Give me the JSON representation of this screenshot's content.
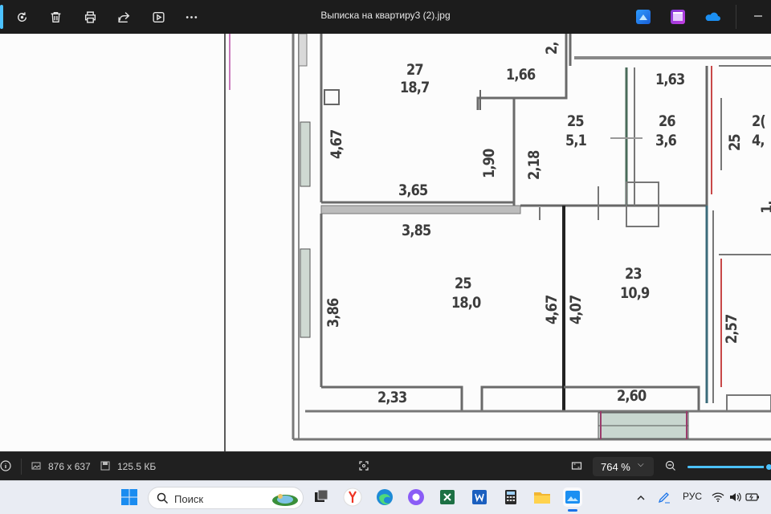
{
  "window": {
    "title": "Выписка на квартиру3 (2).jpg"
  },
  "toolbar": {
    "buttons": [
      {
        "name": "rotate",
        "icon": "rotate-icon"
      },
      {
        "name": "delete",
        "icon": "trash-icon"
      },
      {
        "name": "print",
        "icon": "print-icon"
      },
      {
        "name": "share",
        "icon": "share-icon"
      },
      {
        "name": "slideshow",
        "icon": "play-icon"
      },
      {
        "name": "more",
        "icon": "more-icon"
      }
    ],
    "right_apps": [
      "photo-editor-icon",
      "clipchamp-icon",
      "onedrive-icon"
    ],
    "window_control": "minimize-icon"
  },
  "floorplan": {
    "room_numbers": [
      "27",
      "25",
      "26",
      "25",
      "23"
    ],
    "room_areas": [
      "18,7",
      "5,1",
      "3,6",
      "18,0",
      "10,9"
    ],
    "dimensions": [
      "1,66",
      "1,63",
      "4,67",
      "1,90",
      "2,18",
      "3,65",
      "3,85",
      "3,86",
      "4,67",
      "4,07",
      "2,33",
      "2,60",
      "2,57",
      "2,",
      "1,",
      "25",
      "2(",
      "4,"
    ]
  },
  "status": {
    "info_icon": "info-icon",
    "dimensions": "876 x 637",
    "file_size": "125.5 КБ",
    "zoom": "764 %"
  },
  "taskbar": {
    "search_placeholder": "Поиск",
    "language": "РУС",
    "apps": [
      "windows-start-icon",
      "search-icon",
      "task-view-icon",
      "yandex-browser-icon",
      "edge-icon",
      "alice-icon",
      "excel-icon",
      "word-icon",
      "calculator-icon",
      "file-explorer-icon",
      "photos-icon"
    ]
  },
  "colors": {
    "accent": "#4cc2ff",
    "toolbar_bg": "#1c1c1c",
    "taskbar_bg": "#e9ecf3"
  }
}
